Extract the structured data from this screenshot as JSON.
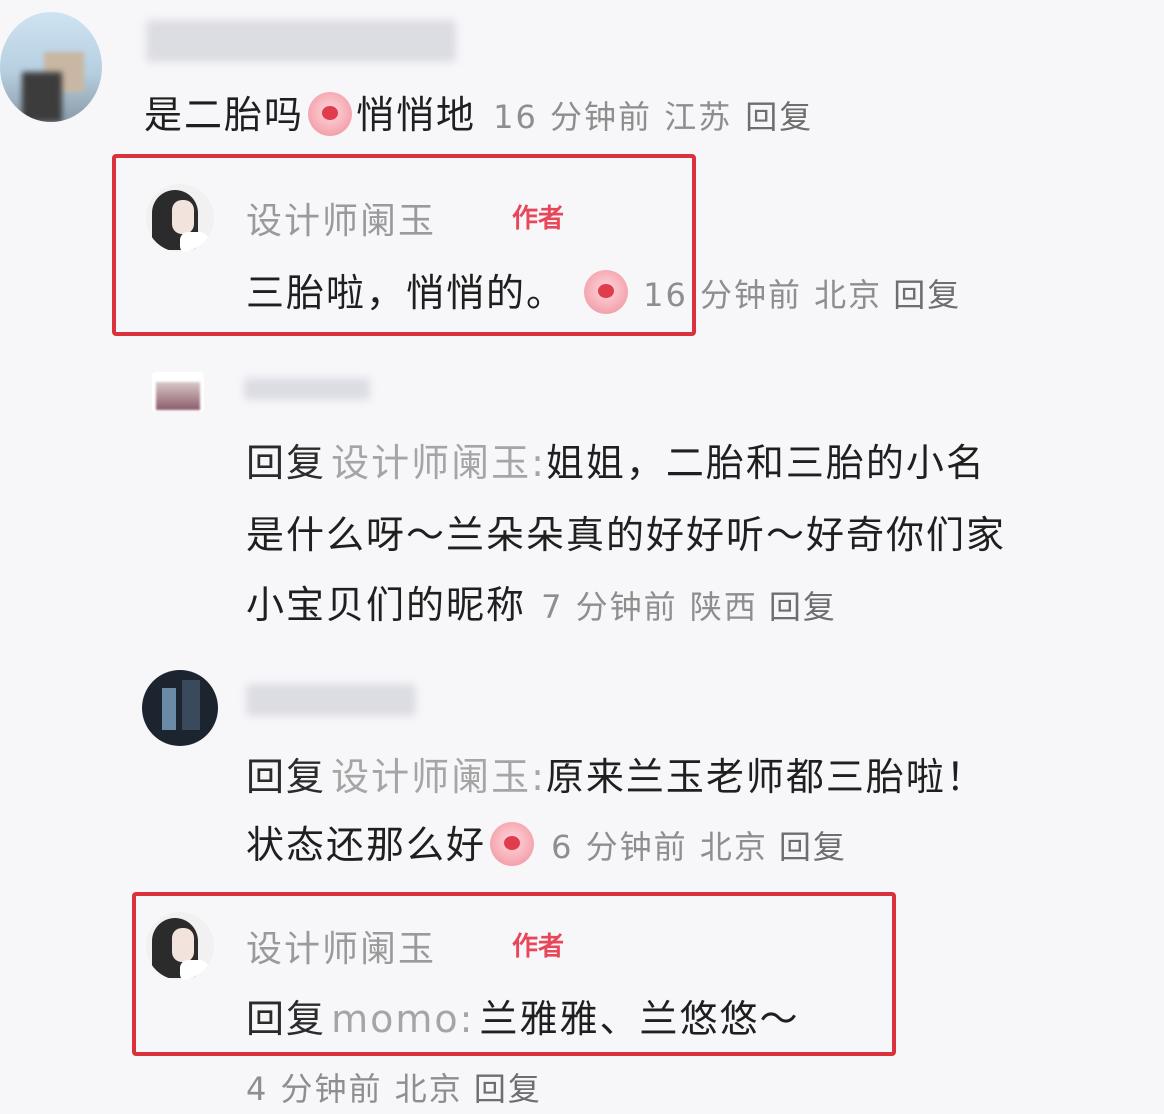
{
  "comment_main": {
    "text": "是二胎吗",
    "emoji_1": "emoji-shy",
    "text_2": "悄悄地",
    "meta": "16 分钟前 江苏",
    "reply": "回复"
  },
  "author_reply_1": {
    "name": "设计师阑玉",
    "badge": "作者",
    "text": "三胎啦，悄悄的。",
    "emoji": "emoji-wink",
    "meta": "16 分钟前 北京",
    "reply": "回复"
  },
  "reply_a": {
    "prefix": "回复",
    "target": "设计师阑玉:",
    "line1": "姐姐，二胎和三胎的小名",
    "line2": "是什么呀～兰朵朵真的好好听～好奇你们家",
    "line3": "小宝贝们的昵称",
    "meta": "7 分钟前 陕西",
    "reply": "回复"
  },
  "reply_b": {
    "prefix": "回复",
    "target": "设计师阑玉:",
    "line1": "原来兰玉老师都三胎啦！",
    "line2": "状态还那么好",
    "emoji": "emoji-heart-eyes",
    "meta": "6 分钟前 北京",
    "reply": "回复"
  },
  "author_reply_2": {
    "name": "设计师阑玉",
    "badge": "作者",
    "prefix": "回复",
    "target": "momo:",
    "text": "兰雅雅、兰悠悠～",
    "meta": "4 分钟前 北京",
    "reply": "回复"
  },
  "colors": {
    "highlight_box": "#d9323c",
    "author_badge": "#e8475a",
    "meta_text": "#8e8e8e"
  }
}
